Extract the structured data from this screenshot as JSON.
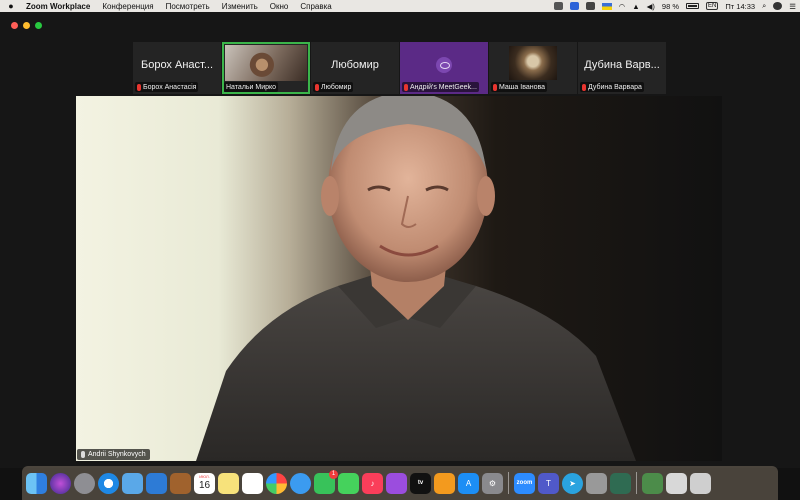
{
  "menubar": {
    "menus": [
      "Zoom Workplace",
      "Конференция",
      "Посмотреть",
      "Изменить",
      "Окно",
      "Справка"
    ],
    "battery": "98 %",
    "clock": "Пт 14:33",
    "input_source": "EN"
  },
  "thumbnails": [
    {
      "big_name": "Борох Анаст...",
      "caption": "Борох Анастасія",
      "muted": true,
      "kind": "name"
    },
    {
      "big_name": "",
      "caption": "Натальи Мирко",
      "muted": false,
      "kind": "photo",
      "active": true
    },
    {
      "big_name": "Любомир",
      "caption": "Любомир",
      "muted": true,
      "kind": "name"
    },
    {
      "big_name": "",
      "caption": "Андрій's MeetGeek...",
      "muted": true,
      "kind": "logo"
    },
    {
      "big_name": "",
      "caption": "Маша Іванова",
      "muted": true,
      "kind": "photo2"
    },
    {
      "big_name": "Дубина Варв...",
      "caption": "Дубина Варвара",
      "muted": true,
      "kind": "name"
    }
  ],
  "speaker": {
    "name": "Andrii Shynkovych"
  },
  "dock": {
    "calendar_month": "ИЮЛ.",
    "calendar_day": "16",
    "zoom_label": "zoom",
    "tv_label": "tv",
    "facetime_badge": "1"
  },
  "colors": {
    "active_speaker": "#3bb54a",
    "muted_mic": "#e8352f",
    "meetgeek_purple": "#5b2a86"
  }
}
